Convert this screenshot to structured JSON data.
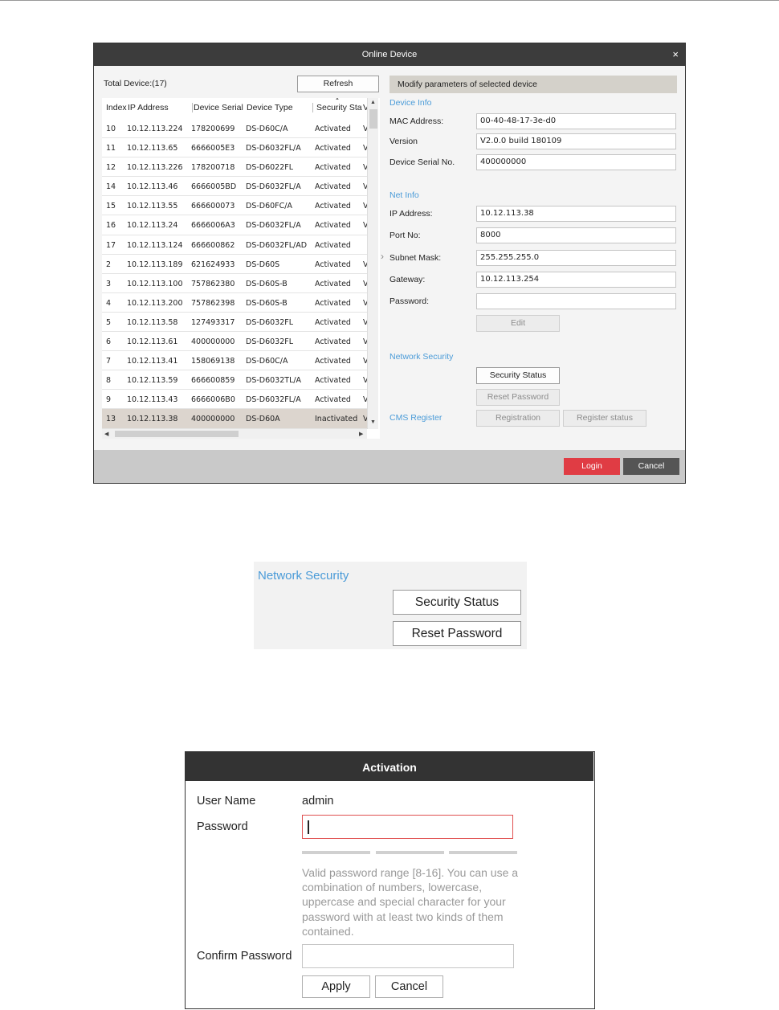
{
  "online_device": {
    "title": "Online Device",
    "close_glyph": "×",
    "total_device": "Total Device:(17)",
    "refresh_label": "Refresh",
    "columns": [
      "Index",
      "IP Address",
      "Device Serial",
      "Device Type",
      "Security Status",
      "V"
    ],
    "rows": [
      [
        "10",
        "10.12.113.224",
        "178200699",
        "DS-D60C/A",
        "Activated",
        "V"
      ],
      [
        "11",
        "10.12.113.65",
        "6666005E3",
        "DS-D6032FL/A",
        "Activated",
        "V"
      ],
      [
        "12",
        "10.12.113.226",
        "178200718",
        "DS-D6022FL",
        "Activated",
        "V"
      ],
      [
        "14",
        "10.12.113.46",
        "6666005BD",
        "DS-D6032FL/A",
        "Activated",
        "V"
      ],
      [
        "15",
        "10.12.113.55",
        "666600073",
        "DS-D60FC/A",
        "Activated",
        "V"
      ],
      [
        "16",
        "10.12.113.24",
        "6666006A3",
        "DS-D6032FL/A",
        "Activated",
        "V"
      ],
      [
        "17",
        "10.12.113.124",
        "666600862",
        "DS-D6032FL/AD",
        "Activated",
        ""
      ],
      [
        "2",
        "10.12.113.189",
        "621624933",
        "DS-D60S",
        "Activated",
        "V"
      ],
      [
        "3",
        "10.12.113.100",
        "757862380",
        "DS-D60S-B",
        "Activated",
        "V"
      ],
      [
        "4",
        "10.12.113.200",
        "757862398",
        "DS-D60S-B",
        "Activated",
        "V"
      ],
      [
        "5",
        "10.12.113.58",
        "127493317",
        "DS-D6032FL",
        "Activated",
        "V"
      ],
      [
        "6",
        "10.12.113.61",
        "400000000",
        "DS-D6032FL",
        "Activated",
        "V"
      ],
      [
        "7",
        "10.12.113.41",
        "158069138",
        "DS-D60C/A",
        "Activated",
        "V"
      ],
      [
        "8",
        "10.12.113.59",
        "666600859",
        "DS-D6032TL/A",
        "Activated",
        "V"
      ],
      [
        "9",
        "10.12.113.43",
        "6666006B0",
        "DS-D6032FL/A",
        "Activated",
        "V"
      ],
      [
        "13",
        "10.12.113.38",
        "400000000",
        "DS-D60A",
        "Inactivated",
        "V"
      ]
    ],
    "selected_row": 15,
    "panel_header": "Modify parameters of selected device",
    "device_info": {
      "section": "Device Info",
      "mac_label": "MAC Address:",
      "mac": "00-40-48-17-3e-d0",
      "version_label": "Version",
      "version": "V2.0.0 build 180109",
      "serial_label": "Device Serial No.",
      "serial": "400000000"
    },
    "net_info": {
      "section": "Net Info",
      "ip_label": "IP Address:",
      "ip": "10.12.113.38",
      "port_label": "Port No:",
      "port": "8000",
      "mask_label": "Subnet Mask:",
      "mask": "255.255.255.0",
      "gateway_label": "Gateway:",
      "gateway": "10.12.113.254",
      "password_label": "Password:",
      "password": "",
      "edit_label": "Edit"
    },
    "network_security": {
      "section": "Network Security",
      "status_label": "Security Status",
      "reset_label": "Reset Password"
    },
    "cms": {
      "section": "CMS Register",
      "registration_label": "Registration",
      "register_status_label": "Register status"
    },
    "login_label": "Login",
    "cancel_label": "Cancel"
  },
  "network_security_zoom": {
    "title": "Network Security",
    "status_label": "Security Status",
    "reset_label": "Reset Password"
  },
  "activation": {
    "title": "Activation",
    "username_label": "User Name",
    "username": "admin",
    "password_label": "Password",
    "password": "",
    "hint": "Valid password range [8-16]. You can use a combination of numbers, lowercase, uppercase and special character for your password with at least two kinds of them contained.",
    "confirm_label": "Confirm Password",
    "confirm": "",
    "apply_label": "Apply",
    "cancel_label": "Cancel"
  },
  "colors": {
    "accent": "#4a9bd8",
    "login": "#e03c44",
    "title_bar": "#3c3c3c",
    "error_border": "#e05050"
  }
}
